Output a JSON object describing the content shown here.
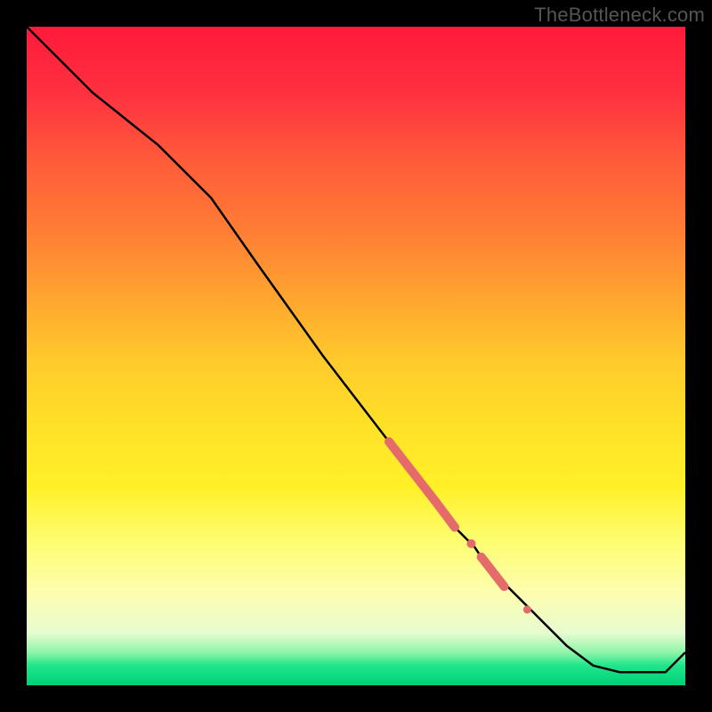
{
  "watermark": "TheBottleneck.com",
  "colors": {
    "line": "#000000",
    "marker": "#e56a6a",
    "frame_bg_top": "#ff1a3a",
    "frame_bg_bottom": "#00d078",
    "page_bg": "#000000"
  },
  "chart_data": {
    "type": "line",
    "title": "",
    "xlabel": "",
    "ylabel": "",
    "xlim": [
      0,
      100
    ],
    "ylim": [
      0,
      100
    ],
    "grid": false,
    "legend": false,
    "series": [
      {
        "name": "curve",
        "x": [
          0,
          5,
          10,
          15,
          20,
          25,
          28,
          35,
          45,
          55,
          62,
          65,
          68,
          70,
          72,
          75,
          78,
          82,
          86,
          90,
          94,
          97,
          100
        ],
        "y": [
          100,
          95,
          90,
          86,
          82,
          77,
          74,
          64,
          50,
          37,
          28,
          24,
          21,
          18,
          16,
          13,
          10,
          6,
          3,
          2,
          2,
          2,
          5
        ]
      }
    ],
    "markers": [
      {
        "shape": "segment",
        "x0": 55,
        "y0": 37,
        "x1": 62,
        "y1": 28,
        "width": 10
      },
      {
        "shape": "segment",
        "x0": 62,
        "y0": 28,
        "x1": 65,
        "y1": 24,
        "width": 10
      },
      {
        "shape": "dot",
        "x": 67.5,
        "y": 21.5,
        "r": 5
      },
      {
        "shape": "segment",
        "x0": 69,
        "y0": 19.5,
        "x1": 72.5,
        "y1": 15,
        "width": 10
      },
      {
        "shape": "dot",
        "x": 76,
        "y": 11.5,
        "r": 4.5
      }
    ]
  }
}
